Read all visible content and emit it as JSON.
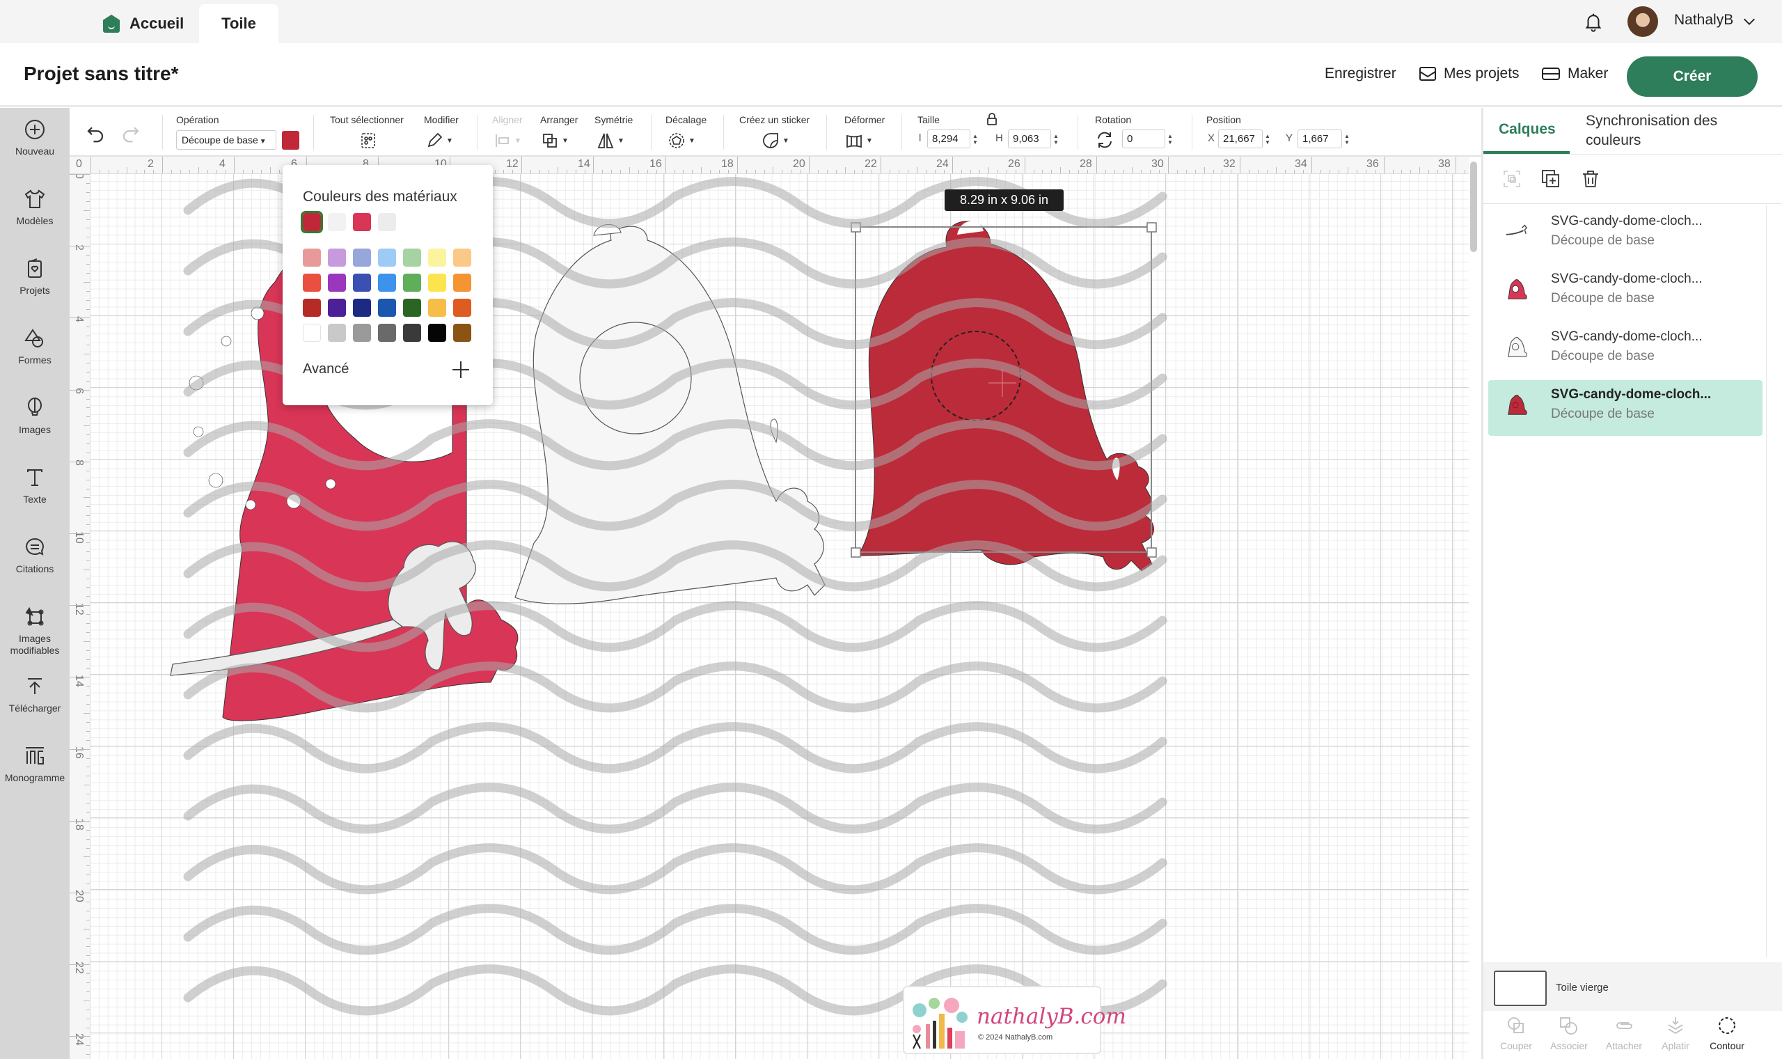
{
  "tabs": [
    {
      "label": "Accueil",
      "icon": "home-icon"
    },
    {
      "label": "Toile",
      "active": true
    }
  ],
  "user": {
    "name": "NathalyB"
  },
  "header": {
    "title": "Projet sans titre*",
    "save_label": "Enregistrer",
    "projects_label": "Mes projets",
    "maker_label": "Maker",
    "create_label": "Créer"
  },
  "sidebar": {
    "items": [
      {
        "label": "Nouveau",
        "icon": "plus-circle-icon"
      },
      {
        "label": "Modèles",
        "icon": "tshirt-icon"
      },
      {
        "label": "Projets",
        "icon": "card-heart-icon"
      },
      {
        "label": "Formes",
        "icon": "shapes-icon"
      },
      {
        "label": "Images",
        "icon": "balloon-icon"
      },
      {
        "label": "Texte",
        "icon": "text-icon"
      },
      {
        "label": "Citations",
        "icon": "quote-bubble-icon"
      },
      {
        "label": "Images modifiables",
        "icon": "editable-image-icon"
      },
      {
        "label": "Télécharger",
        "icon": "upload-icon"
      },
      {
        "label": "Monogramme",
        "icon": "monogram-icon"
      }
    ]
  },
  "toolbar": {
    "operation_label": "Opération",
    "operation_value": "Découpe de base",
    "operation_color": "#c0283a",
    "select_all_label": "Tout sélectionner",
    "modify_label": "Modifier",
    "align_label": "Aligner",
    "arrange_label": "Arranger",
    "symmetry_label": "Symétrie",
    "offset_label": "Décalage",
    "sticker_label": "Créez un sticker",
    "warp_label": "Déformer",
    "size_label": "Taille",
    "width_axis": "l",
    "width_value": "8,294",
    "height_axis": "H",
    "height_value": "9,063",
    "rotation_label": "Rotation",
    "rotation_value": "0",
    "position_label": "Position",
    "x_axis": "X",
    "x_value": "21,667",
    "y_axis": "Y",
    "y_value": "1,667"
  },
  "rulers": {
    "top": [
      "0",
      "2",
      "4",
      "6",
      "8",
      "10",
      "12",
      "14",
      "16",
      "18",
      "20",
      "22",
      "24",
      "26",
      "28",
      "30",
      "32",
      "34",
      "36",
      "38"
    ],
    "left": [
      "0",
      "2",
      "4",
      "6",
      "8",
      "10",
      "12",
      "14",
      "16",
      "18",
      "20",
      "22",
      "24"
    ]
  },
  "canvas": {
    "dimension_tooltip": "8.29  in x 9.06  in",
    "watermark_brand": "nathalyB.com",
    "watermark_copyright": "© 2024 NathalyB.com"
  },
  "color_popup": {
    "title": "Couleurs des matériaux",
    "recent": [
      "#c0283a",
      "#f2f2f2",
      "#d93556",
      "#ececec"
    ],
    "selected_index": 0,
    "palette": [
      [
        "#e89a9a",
        "#c79ade",
        "#97a6db",
        "#9ecbf5",
        "#a5d3a2",
        "#fcf39e",
        "#fbc987"
      ],
      [
        "#e9503f",
        "#9a37bd",
        "#3a50b3",
        "#3d93ea",
        "#5fae59",
        "#fbe44e",
        "#f49432"
      ],
      [
        "#b52b26",
        "#4d2097",
        "#1c2a84",
        "#1b57ae",
        "#2b6523",
        "#f6bd49",
        "#de5b22"
      ],
      [
        "#ffffff",
        "#c9c9c9",
        "#9a9a9a",
        "#6a6a6a",
        "#3a3a3a",
        "#050505",
        "#8a5414"
      ]
    ],
    "advanced_label": "Avancé"
  },
  "right_panel": {
    "tabs": [
      {
        "label": "Calques",
        "active": true
      },
      {
        "label": "Synchronisation des couleurs"
      }
    ],
    "layers": [
      {
        "name": "SVG-candy-dome-cloch...",
        "operation": "Découpe de base",
        "thumb": "ribbon",
        "selected": false
      },
      {
        "name": "SVG-candy-dome-cloch...",
        "operation": "Découpe de base",
        "thumb": "pink-bell",
        "selected": false
      },
      {
        "name": "SVG-candy-dome-cloch...",
        "operation": "Découpe de base",
        "thumb": "white-bell",
        "selected": false
      },
      {
        "name": "SVG-candy-dome-cloch...",
        "operation": "Découpe de base",
        "thumb": "red-bell",
        "selected": true
      }
    ],
    "blank_canvas_label": "Toile vierge",
    "bottom_tools": [
      {
        "label": "Couper",
        "enabled": false
      },
      {
        "label": "Associer",
        "enabled": false
      },
      {
        "label": "Attacher",
        "enabled": false
      },
      {
        "label": "Aplatir",
        "enabled": false
      },
      {
        "label": "Contour",
        "enabled": true
      }
    ]
  }
}
